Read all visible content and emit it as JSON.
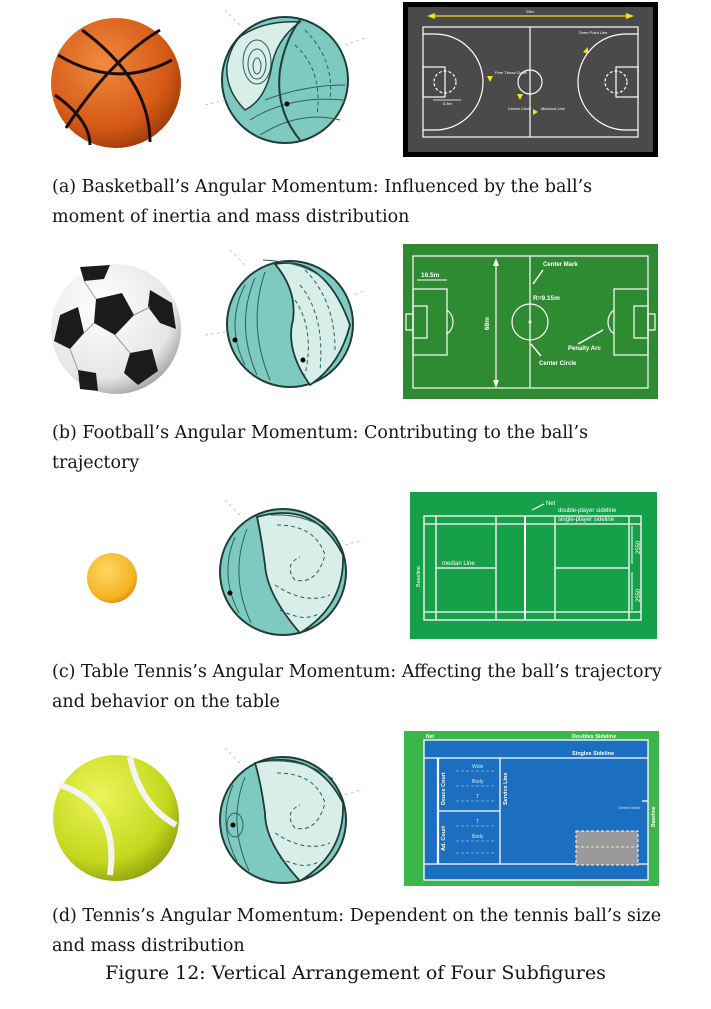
{
  "subfigures": [
    {
      "caption": "(a) Basketball’s Angular Momentum: Influenced by the ball’s moment of inertia and mass distribution",
      "court": {
        "width_label": "28m",
        "three_point_label": "Three Point Line",
        "free_throw_label": "Free Throw Circle",
        "radius_label": "5.8m",
        "centre_label": "Centre Circle",
        "midcourt_label": "Midcourt Line"
      }
    },
    {
      "caption": "(b) Football’s Angular Momentum: Contributing to the ball’s trajectory",
      "field": {
        "box_label": "16.5m",
        "center_mark_label": "Center Mark",
        "radius_label": "R=9.15m",
        "length_label": "68m",
        "penalty_arc_label": "Penalty Arc",
        "center_circle_label": "Center Circle"
      }
    },
    {
      "caption": "(c) Table Tennis’s Angular Momentum: Affecting the ball’s trajectory and behavior on the table",
      "table": {
        "net_label": "Net",
        "double_sideline_label": "double-player sideline",
        "single_sideline_label": "single-player sideline",
        "median_label": "median Line",
        "baseline_label": "Baseline",
        "dim_top": "2550",
        "dim_bottom": "2550"
      }
    },
    {
      "caption": "(d) Tennis’s Angular Momentum: Dependent on the tennis ball’s size and mass distribution",
      "court": {
        "net_label": "Net",
        "doubles_label": "Doubles Sideline",
        "singles_label": "Singles Sideline",
        "wide_label": "Wide",
        "body_label": "Body",
        "t_label": "T",
        "t2_label": "T",
        "body2_label": "Body",
        "deuce_label": "Deuce Court",
        "ad_label": "Ad. Court",
        "service_label": "Service Line",
        "center_mark_label": "Center Mark",
        "baseline_label": "Baseline"
      }
    }
  ],
  "figure_caption": "Figure 12: Vertical Arrangement of Four Subfigures",
  "colors": {
    "basketball": "#d9631f",
    "sphere_teal": "#7ecac1",
    "sphere_light": "#d8eee8",
    "bb_court": "#4a4a4a",
    "football_field": "#2e8b32",
    "table_green": "#16a04a",
    "tennis_blue": "#1c6fc0",
    "tennis_outer": "#3cb54a",
    "ping_pong": "#f4b321",
    "tennis_ball": "#cfe02a"
  }
}
